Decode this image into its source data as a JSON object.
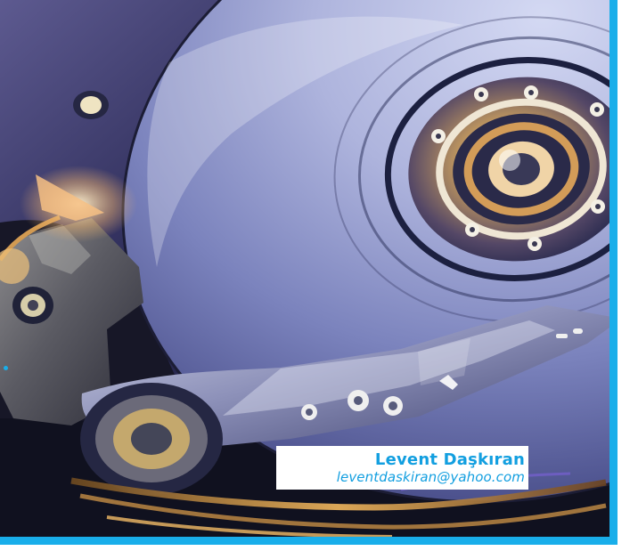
{
  "author": {
    "name": "Levent Daşkıran",
    "email": "leventdaskiran@yahoo.com"
  },
  "photo": {
    "subject": "hard-disk-drive-platter"
  },
  "colors": {
    "accent": "#19aeea",
    "text": "#129fe0",
    "background": "#ffffff"
  }
}
